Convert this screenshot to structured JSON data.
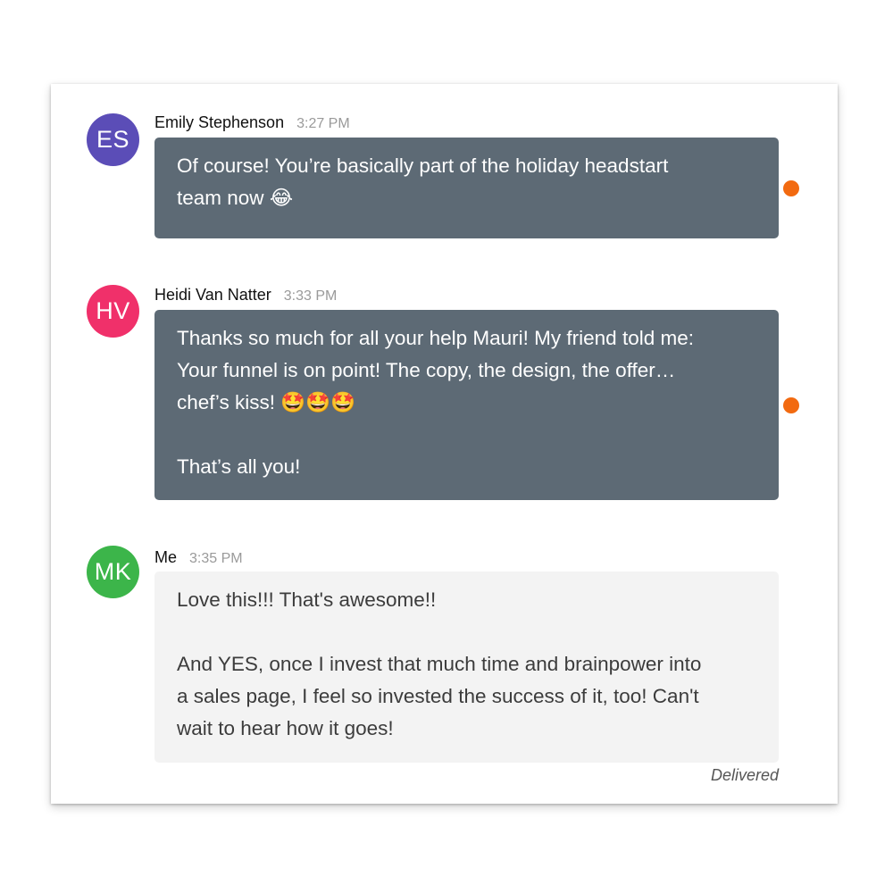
{
  "messages": [
    {
      "initials": "ES",
      "avatar_color": "#5b4db7",
      "sender": "Emily Stephenson",
      "time": "3:27 PM",
      "lines": [
        "Of course! You’re basically part of the holiday headstart",
        "team now 😂"
      ],
      "unread_indicator": true
    },
    {
      "initials": "HV",
      "avatar_color": "#f0306a",
      "sender": "Heidi Van Natter",
      "time": "3:33 PM",
      "lines": [
        "Thanks so much for all your help Mauri! My friend told me:",
        "Your funnel is on point! The copy, the design, the offer…",
        "chef’s kiss! 🤩🤩🤩",
        "",
        "That’s all you!"
      ],
      "unread_indicator": true
    },
    {
      "initials": "MK",
      "avatar_color": "#3cb54a",
      "sender": "Me",
      "time": "3:35 PM",
      "lines": [
        "Love this!!! That's awesome!!",
        "",
        "And YES, once I invest that much time and brainpower into",
        "a sales page, I feel so invested the success of it, too! Can't",
        "wait to hear how it goes!"
      ],
      "unread_indicator": false
    }
  ],
  "status": "Delivered",
  "colors": {
    "incoming_bubble": "#5d6a75",
    "outgoing_bubble": "#f3f3f3",
    "unread_dot": "#f26a10"
  }
}
